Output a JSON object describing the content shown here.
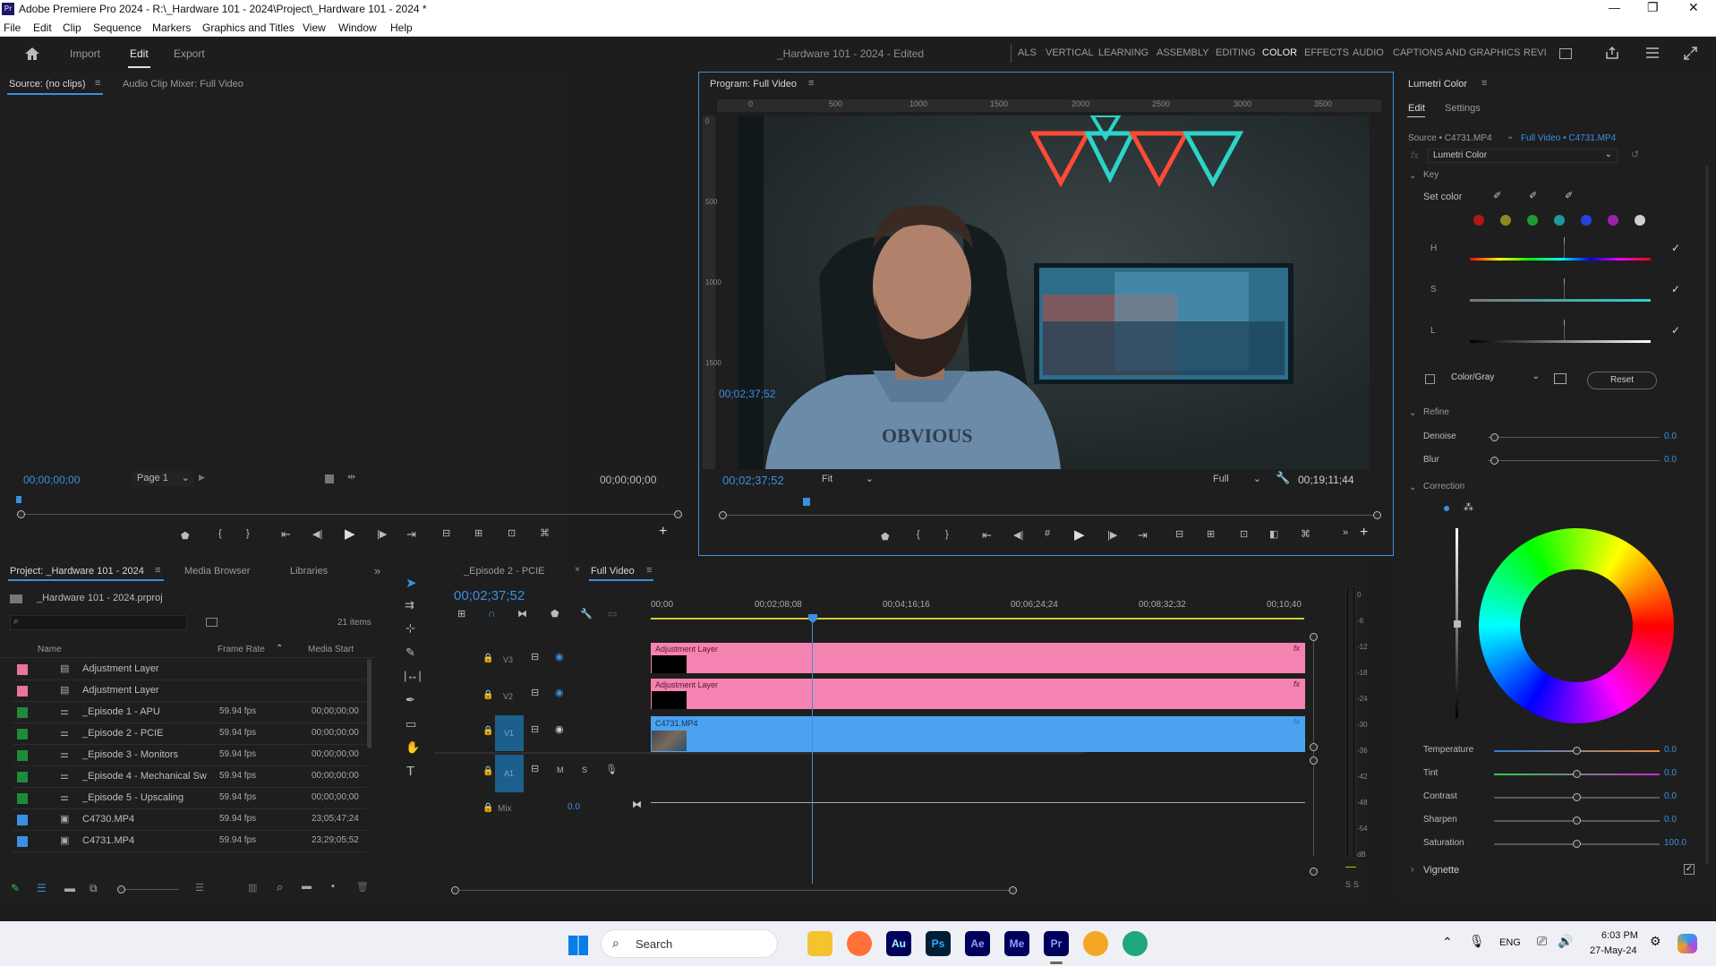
{
  "window": {
    "title": "Adobe Premiere Pro 2024 - R:\\_Hardware 101 - 2024\\Project\\_Hardware 101 - 2024 *",
    "app_badge": "Pr"
  },
  "menu": [
    "File",
    "Edit",
    "Clip",
    "Sequence",
    "Markers",
    "Graphics and Titles",
    "View",
    "Window",
    "Help"
  ],
  "header": {
    "modes": [
      "Import",
      "Edit",
      "Export"
    ],
    "project_status": "_Hardware 101 - 2024 - Edited",
    "workspaces": [
      "ALS",
      "VERTICAL",
      "LEARNING",
      "ASSEMBLY",
      "EDITING",
      "COLOR",
      "EFFECTS",
      "AUDIO",
      "CAPTIONS AND GRAPHICS",
      "REVI"
    ]
  },
  "source": {
    "tab_source": "Source: (no clips)",
    "tab_mixer": "Audio Clip Mixer: Full Video",
    "timecode_in": "00;00;00;00",
    "page": "Page 1",
    "timecode_out": "00;00;00;00"
  },
  "program": {
    "title": "Program: Full Video",
    "ruler": [
      "0",
      "500",
      "1000",
      "1500",
      "2000",
      "2500",
      "3000",
      "3500"
    ],
    "vruler": [
      "0",
      "500",
      "1000",
      "1500"
    ],
    "timecode": "00;02;37;52",
    "fit": "Fit",
    "quality": "Full",
    "duration": "00;19;11;44",
    "shirt_text": "OBVIOUS",
    "playhead_fraction": 0.13
  },
  "project": {
    "tabs": [
      "Project: _Hardware 101 - 2024",
      "Media Browser",
      "Libraries"
    ],
    "file": "_Hardware 101 - 2024.prproj",
    "item_count": "21 items",
    "columns": [
      "Name",
      "Frame Rate",
      "Media Start"
    ],
    "items": [
      {
        "name": "Adjustment Layer",
        "rate": "",
        "start": "",
        "color": "#e8739c",
        "icon": "adjustment-icon"
      },
      {
        "name": "Adjustment Layer",
        "rate": "",
        "start": "",
        "color": "#e8739c",
        "icon": "adjustment-icon"
      },
      {
        "name": "_Episode 1 - APU",
        "rate": "59.94 fps",
        "start": "00;00;00;00",
        "color": "#1e8a3a",
        "icon": "sequence-icon"
      },
      {
        "name": "_Episode 2 - PCIE",
        "rate": "59.94 fps",
        "start": "00;00;00;00",
        "color": "#1e8a3a",
        "icon": "sequence-icon"
      },
      {
        "name": "_Episode 3 - Monitors",
        "rate": "59.94 fps",
        "start": "00;00;00;00",
        "color": "#1e8a3a",
        "icon": "sequence-icon"
      },
      {
        "name": "_Episode 4 - Mechanical Sw",
        "rate": "59.94 fps",
        "start": "00;00;00;00",
        "color": "#1e8a3a",
        "icon": "sequence-icon"
      },
      {
        "name": "_Episode 5 - Upscaling",
        "rate": "59.94 fps",
        "start": "00;00;00;00",
        "color": "#1e8a3a",
        "icon": "sequence-icon"
      },
      {
        "name": "C4730.MP4",
        "rate": "59.94 fps",
        "start": "23;05;47;24",
        "color": "#3b8fe0",
        "icon": "clip-icon"
      },
      {
        "name": "C4731.MP4",
        "rate": "59.94 fps",
        "start": "23;29;05;52",
        "color": "#3b8fe0",
        "icon": "clip-icon"
      }
    ]
  },
  "timeline": {
    "tabs": [
      "_Episode 2 - PCIE",
      "Full Video"
    ],
    "timecode": "00;02;37;52",
    "ruler": [
      "00;00",
      "00;02;08;08",
      "00;04;16;16",
      "00;06;24;24",
      "00;08;32;32",
      "00;10;40"
    ],
    "tracks": [
      {
        "label": "V3",
        "clip": "Adjustment Layer",
        "fx": "fx"
      },
      {
        "label": "V2",
        "clip": "Adjustment Layer",
        "fx": "fx"
      },
      {
        "label": "V1",
        "clip": "C4731.MP4",
        "fx": "fx"
      },
      {
        "label": "A1",
        "clip": "",
        "fx": ""
      }
    ],
    "mute": "M",
    "solo": "S",
    "mix_label": "Mix",
    "mix_value": "0.0",
    "meter_scale": [
      "0",
      "-6",
      "-12",
      "-18",
      "-24",
      "-30",
      "-36",
      "-42",
      "-48",
      "-54",
      "dB"
    ],
    "meter_solo": [
      "S",
      "S"
    ]
  },
  "lumetri": {
    "title": "Lumetri Color",
    "tabs": [
      "Edit",
      "Settings"
    ],
    "source": "Source • C4731.MP4",
    "target": "Full Video • C4731.MP4",
    "effect": "Lumetri Color",
    "key_section": "Key",
    "set_color": "Set color",
    "swatches": [
      "#b01818",
      "#8a8a1e",
      "#1e9a32",
      "#1a9a9a",
      "#2244dd",
      "#9a22aa",
      "#d0d0d0"
    ],
    "hsl": [
      "H",
      "S",
      "L"
    ],
    "mode": "Color/Gray",
    "reset": "Reset",
    "refine": "Refine",
    "refine_rows": [
      {
        "label": "Denoise",
        "value": "0.0"
      },
      {
        "label": "Blur",
        "value": "0.0"
      }
    ],
    "correction": "Correction",
    "sliders": [
      {
        "label": "Temperature",
        "value": "0.0"
      },
      {
        "label": "Tint",
        "value": "0.0"
      },
      {
        "label": "Contrast",
        "value": "0.0"
      },
      {
        "label": "Sharpen",
        "value": "0.0"
      },
      {
        "label": "Saturation",
        "value": "100.0"
      }
    ],
    "vignette": "Vignette"
  },
  "taskbar": {
    "search": "Search",
    "apps": [
      "Au",
      "Ps",
      "Ae",
      "Me",
      "Pr"
    ],
    "lang": "ENG",
    "time": "6:03 PM",
    "date": "27-May-24"
  }
}
